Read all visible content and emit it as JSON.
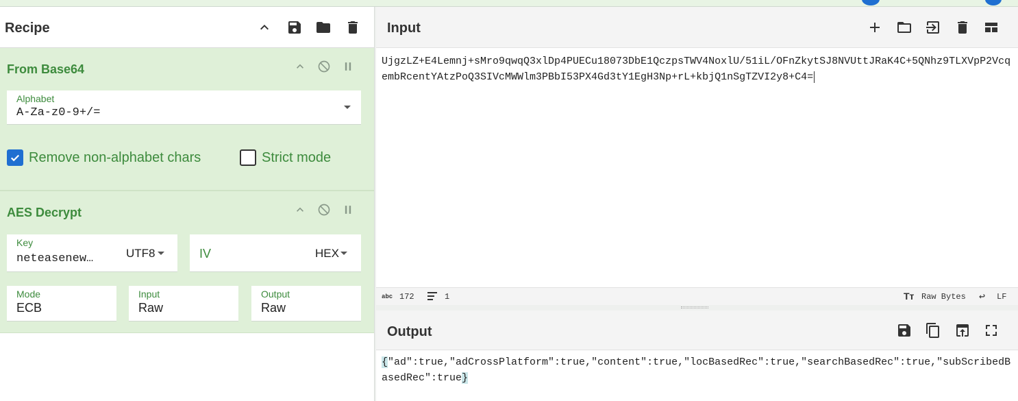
{
  "recipe": {
    "title": "Recipe",
    "operations": [
      {
        "name": "From Base64",
        "alphabet_label": "Alphabet",
        "alphabet_value": "A-Za-z0-9+/=",
        "remove_non_alphabet_label": "Remove non-alphabet chars",
        "remove_non_alphabet_checked": true,
        "strict_mode_label": "Strict mode",
        "strict_mode_checked": false
      },
      {
        "name": "AES Decrypt",
        "key_label": "Key",
        "key_value": "neteasenew…",
        "key_encoding": "UTF8",
        "iv_label": "IV",
        "iv_encoding": "HEX",
        "mode_label": "Mode",
        "mode_value": "ECB",
        "input_label": "Input",
        "input_value": "Raw",
        "output_label": "Output",
        "output_value": "Raw"
      }
    ]
  },
  "input": {
    "title": "Input",
    "text": "UjgzLZ+E4Lemnj+sMro9qwqQ3xlDp4PUECu18073DbE1QczpsTWV4NoxlU/51iL/OFnZkytSJ8NVUttJRaK4C+5QNhz9TLXVpP2VcqembRcentYAtzPoQ3SIVcMWWlm3PBbI53PX4Gd3tY1EgH3Np+rL+kbjQ1nSgTZVI2y8+C4=",
    "char_count_icon": "abc",
    "char_count": "172",
    "line_count": "1",
    "encoding": "Raw Bytes",
    "eol": "LF"
  },
  "output": {
    "title": "Output",
    "open_brace": "{",
    "body": "\"ad\":true,\"adCrossPlatform\":true,\"content\":true,\"locBasedRec\":true,\"searchBasedRec\":true,\"subScribedBasedRec\":true",
    "close_brace": "}"
  },
  "colors": {
    "op_bg": "#dff0d8",
    "op_title": "#3d8b3d",
    "checkbox_on": "#1f6fd1"
  }
}
